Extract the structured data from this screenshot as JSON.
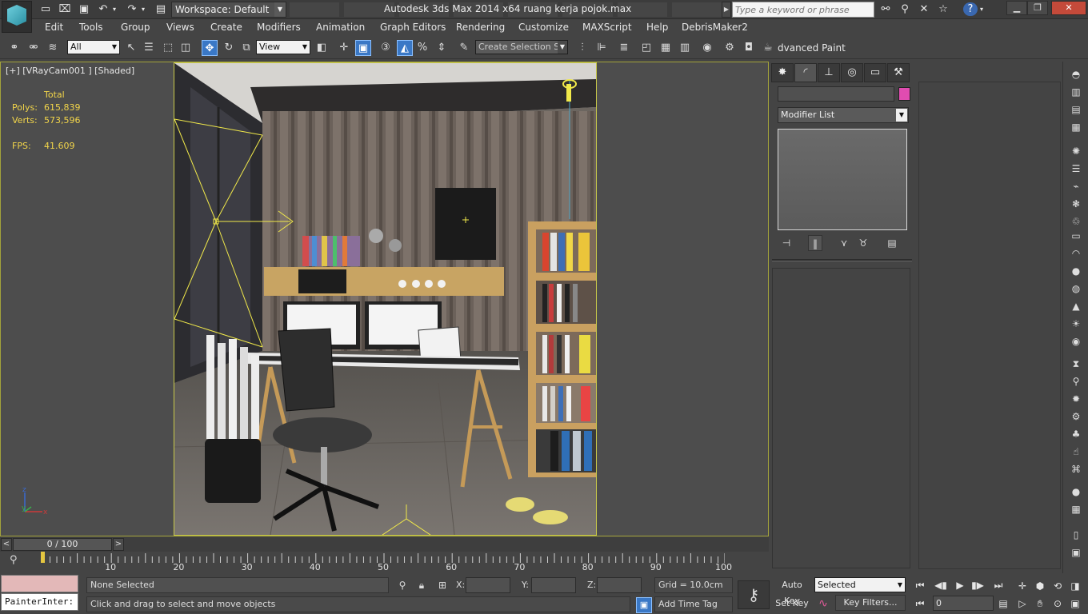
{
  "title_bar": {
    "workspace": "Workspace: Default",
    "app_title": "Autodesk 3ds Max  2014 x64     ruang kerja pojok.max",
    "search_placeholder": "Type a keyword or phrase"
  },
  "menu": [
    "Edit",
    "Tools",
    "Group",
    "Views",
    "Create",
    "Modifiers",
    "Animation",
    "Graph Editors",
    "Rendering",
    "Customize",
    "MAXScript",
    "Help",
    "DebrisMaker2"
  ],
  "toolbar": {
    "selection_filter": "All",
    "reference_coord": "View",
    "named_selection_set": "Create Selection Se",
    "advanced_paint": "dvanced Paint"
  },
  "viewport": {
    "label": "[+] [VRayCam001 ] [Shaded]",
    "stats": {
      "header": "Total",
      "polys_label": "Polys:",
      "polys_value": "615,839",
      "verts_label": "Verts:",
      "verts_value": "573,596",
      "fps_label": "FPS:",
      "fps_value": "41.609"
    },
    "axis": {
      "z": "z",
      "y": "y",
      "x": "x"
    }
  },
  "command_panel": {
    "modifier_list": "Modifier List",
    "object_color": "#e04cb0",
    "tab_icons": [
      "create-icon",
      "modify-icon",
      "hierarchy-icon",
      "motion-icon",
      "display-icon",
      "utilities-icon"
    ]
  },
  "time_slider": {
    "value": "0 / 100",
    "position_fraction": 0
  },
  "trackbar": {
    "ticks": [
      "10",
      "20",
      "30",
      "40",
      "50",
      "60",
      "70",
      "80",
      "90",
      "100"
    ]
  },
  "status": {
    "script_listener": "PainterInter:",
    "selection_info": "None Selected",
    "prompt": "Click and drag to select and move objects",
    "x_label": "X:",
    "y_label": "Y:",
    "z_label": "Z:",
    "grid": "Grid = 10.0cm",
    "add_time_tag": "Add Time Tag",
    "auto_key": "Auto Key",
    "set_key": "Set Key",
    "key_mode": "Selected",
    "key_filters": "Key Filters...",
    "current_frame": "0"
  },
  "colors": {
    "accent_active": "#3a78c6",
    "viewport_border": "#a3a33b",
    "stats_text": "#f2d54a"
  }
}
